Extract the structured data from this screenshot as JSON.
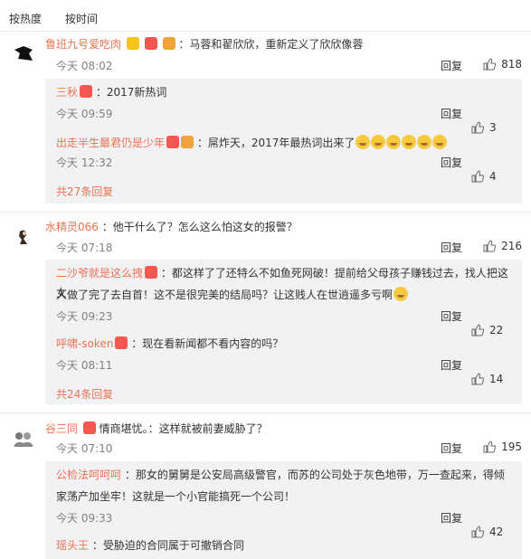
{
  "sort": {
    "hot": "按热度",
    "time": "按时间"
  },
  "c1": {
    "user": "鲁班九号爱吃肉",
    "text": "：马蓉和翟欣欣，重新定义了欣欣像蓉",
    "time": "今天 08:02",
    "reply": "回复",
    "likes": "818",
    "replies": [
      {
        "user": "三秋",
        "text": "：2017新热词",
        "time": "今天 09:59",
        "reply": "回复",
        "likes": "3"
      },
      {
        "user": "出走半生最君仍是少年",
        "text": "：屌炸天，2017年最热词出来了",
        "time": "今天 12:32",
        "reply": "回复",
        "likes": "4"
      }
    ],
    "more": "共27条回复"
  },
  "c2": {
    "user": "水精灵066",
    "text": "：他干什么了？怎么这么怕这女的报警？",
    "time": "今天 07:18",
    "reply": "回复",
    "likes": "216",
    "replies": [
      {
        "user": "二沙爷就是这么拽",
        "text": "：都这样了了还特么不如鱼死网破！提前给父母孩子赚钱过去，找人把这女",
        "text2": "人做了完了去自首！这不是很完美的结局吗？让这贱人在世逍遥多亏啊",
        "time": "今天 09:23",
        "reply": "回复",
        "likes": "22"
      },
      {
        "user": "呼啸-soken",
        "text": "：现在看新闻都不看内容的吗？",
        "time": "今天 08:11",
        "reply": "回复",
        "likes": "14"
      }
    ],
    "more": "共24条回复"
  },
  "c3": {
    "user": "谷三同",
    "text": "情商堪忧。：这样就被前妻威胁了？",
    "time": "今天 07:10",
    "reply": "回复",
    "likes": "195",
    "replies": [
      {
        "user": "公检法呵呵呵",
        "text": "：那女的舅舅是公安局高级警官，而苏的公司处于灰色地带，万一查起来，得倾",
        "text2": "家荡产加坐牢！这就是一个小官能搞死一个公司！",
        "time": "今天 09:33",
        "reply": "回复",
        "likes": "42"
      },
      {
        "user": "瑶头王",
        "text": "：受胁迫的合同属于可撤销合同"
      }
    ]
  }
}
